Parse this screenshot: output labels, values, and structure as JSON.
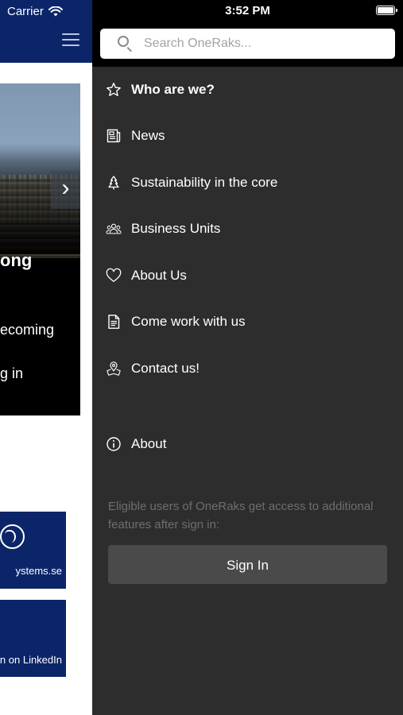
{
  "status_bar": {
    "carrier": "Carrier",
    "time": "3:52 PM"
  },
  "background_app": {
    "hero": {
      "headline": "ong",
      "line1": "ecoming",
      "line2": "g in"
    },
    "cards": [
      {
        "text": "ystems.se",
        "icon": "globe-icon"
      },
      {
        "text": "n on LinkedIn",
        "icon": "linkedin-icon"
      }
    ]
  },
  "drawer": {
    "search": {
      "placeholder": "Search OneRaks..."
    },
    "menu": [
      {
        "label": "Who are we?",
        "icon": "star-icon",
        "bold": true
      },
      {
        "label": "News",
        "icon": "newspaper-icon"
      },
      {
        "label": "Sustainability in the core",
        "icon": "tree-icon"
      },
      {
        "label": "Business Units",
        "icon": "team-icon"
      },
      {
        "label": "About Us",
        "icon": "heart-icon"
      },
      {
        "label": "Come work with us",
        "icon": "document-icon"
      },
      {
        "label": "Contact us!",
        "icon": "map-pin-icon"
      },
      {
        "label": "About",
        "icon": "info-icon"
      }
    ],
    "sign_in_info": "Eligible users of OneRaks get access to additional features after sign in:",
    "sign_in_label": "Sign In"
  },
  "colors": {
    "brand_navy": "#0c2569",
    "drawer_bg": "#2d2d2d",
    "drawer_header_bg": "#000000",
    "button_bg": "#4a4a4a"
  }
}
